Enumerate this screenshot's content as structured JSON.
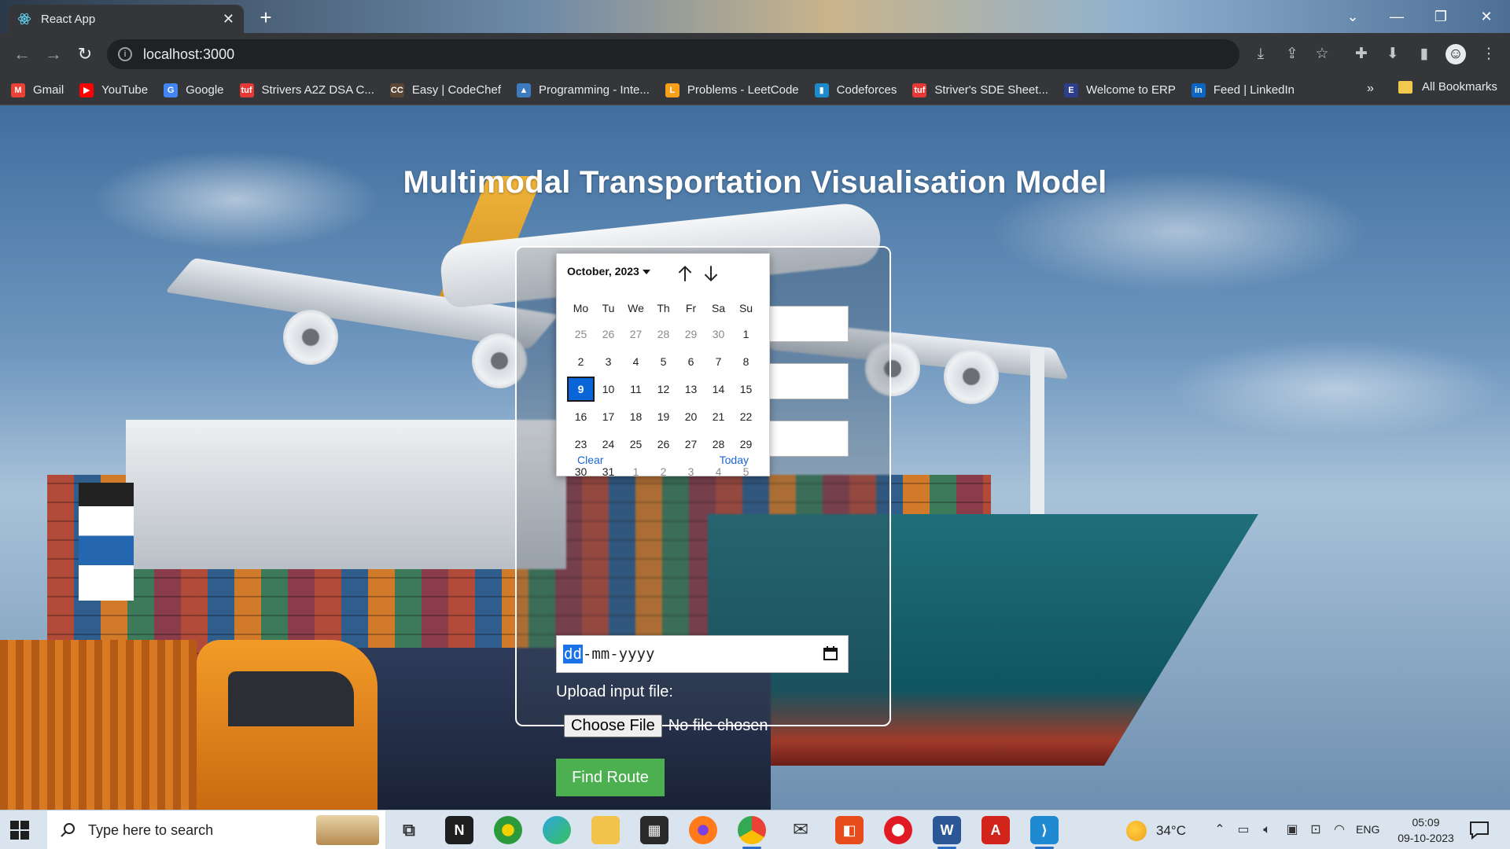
{
  "browser": {
    "tab_title": "React App",
    "url": "localhost:3000"
  },
  "bookmarks": [
    {
      "label": "Gmail",
      "color": "#ea4335",
      "icon": "M"
    },
    {
      "label": "YouTube",
      "color": "#ff0000",
      "icon": "▶"
    },
    {
      "label": "Google",
      "color": "#4285f4",
      "icon": "G"
    },
    {
      "label": "Strivers A2Z DSA C...",
      "color": "#e53935",
      "icon": "tuf"
    },
    {
      "label": "Easy | CodeChef",
      "color": "#5b4636",
      "icon": "CC"
    },
    {
      "label": "Programming - Inte...",
      "color": "#3c7bbf",
      "icon": "▲"
    },
    {
      "label": "Problems - LeetCode",
      "color": "#f89f1b",
      "icon": "L"
    },
    {
      "label": "Codeforces",
      "color": "#1f8acb",
      "icon": "▮"
    },
    {
      "label": "Striver's SDE Sheet...",
      "color": "#e53935",
      "icon": "tuf"
    },
    {
      "label": "Welcome to ERP",
      "color": "#2d3e8c",
      "icon": "E"
    },
    {
      "label": "Feed | LinkedIn",
      "color": "#0a66c2",
      "icon": "in"
    }
  ],
  "bookmarks_more": "»",
  "bookmarks_all": "All Bookmarks",
  "page": {
    "title": "Multimodal Transportation Visualisation Model",
    "date_placeholder": {
      "dd": "dd",
      "rest": "-mm-yyyy"
    },
    "upload_label": "Upload input file:",
    "choose_file": "Choose File",
    "no_file": "No file chosen",
    "find_route": "Find Route"
  },
  "calendar": {
    "month_label": "October, 2023",
    "weekdays": [
      "Mo",
      "Tu",
      "We",
      "Th",
      "Fr",
      "Sa",
      "Su"
    ],
    "weeks": [
      [
        {
          "d": "25",
          "m": true
        },
        {
          "d": "26",
          "m": true
        },
        {
          "d": "27",
          "m": true
        },
        {
          "d": "28",
          "m": true
        },
        {
          "d": "29",
          "m": true
        },
        {
          "d": "30",
          "m": true
        },
        {
          "d": "1"
        }
      ],
      [
        {
          "d": "2"
        },
        {
          "d": "3"
        },
        {
          "d": "4"
        },
        {
          "d": "5"
        },
        {
          "d": "6"
        },
        {
          "d": "7"
        },
        {
          "d": "8"
        }
      ],
      [
        {
          "d": "9",
          "s": true
        },
        {
          "d": "10"
        },
        {
          "d": "11"
        },
        {
          "d": "12"
        },
        {
          "d": "13"
        },
        {
          "d": "14"
        },
        {
          "d": "15"
        }
      ],
      [
        {
          "d": "16"
        },
        {
          "d": "17"
        },
        {
          "d": "18"
        },
        {
          "d": "19"
        },
        {
          "d": "20"
        },
        {
          "d": "21"
        },
        {
          "d": "22"
        }
      ],
      [
        {
          "d": "23"
        },
        {
          "d": "24"
        },
        {
          "d": "25"
        },
        {
          "d": "26"
        },
        {
          "d": "27"
        },
        {
          "d": "28"
        },
        {
          "d": "29"
        }
      ],
      [
        {
          "d": "30"
        },
        {
          "d": "31"
        },
        {
          "d": "1",
          "m": true
        },
        {
          "d": "2",
          "m": true
        },
        {
          "d": "3",
          "m": true
        },
        {
          "d": "4",
          "m": true
        },
        {
          "d": "5",
          "m": true
        }
      ]
    ],
    "clear": "Clear",
    "today": "Today"
  },
  "taskbar": {
    "search_placeholder": "Type here to search",
    "weather": "34°C",
    "language": "ENG",
    "time": "05:09",
    "date": "09-10-2023"
  },
  "colors": {
    "accent_button": "#4caf50",
    "selected_day": "#0a66d8",
    "link": "#1a66d2"
  }
}
